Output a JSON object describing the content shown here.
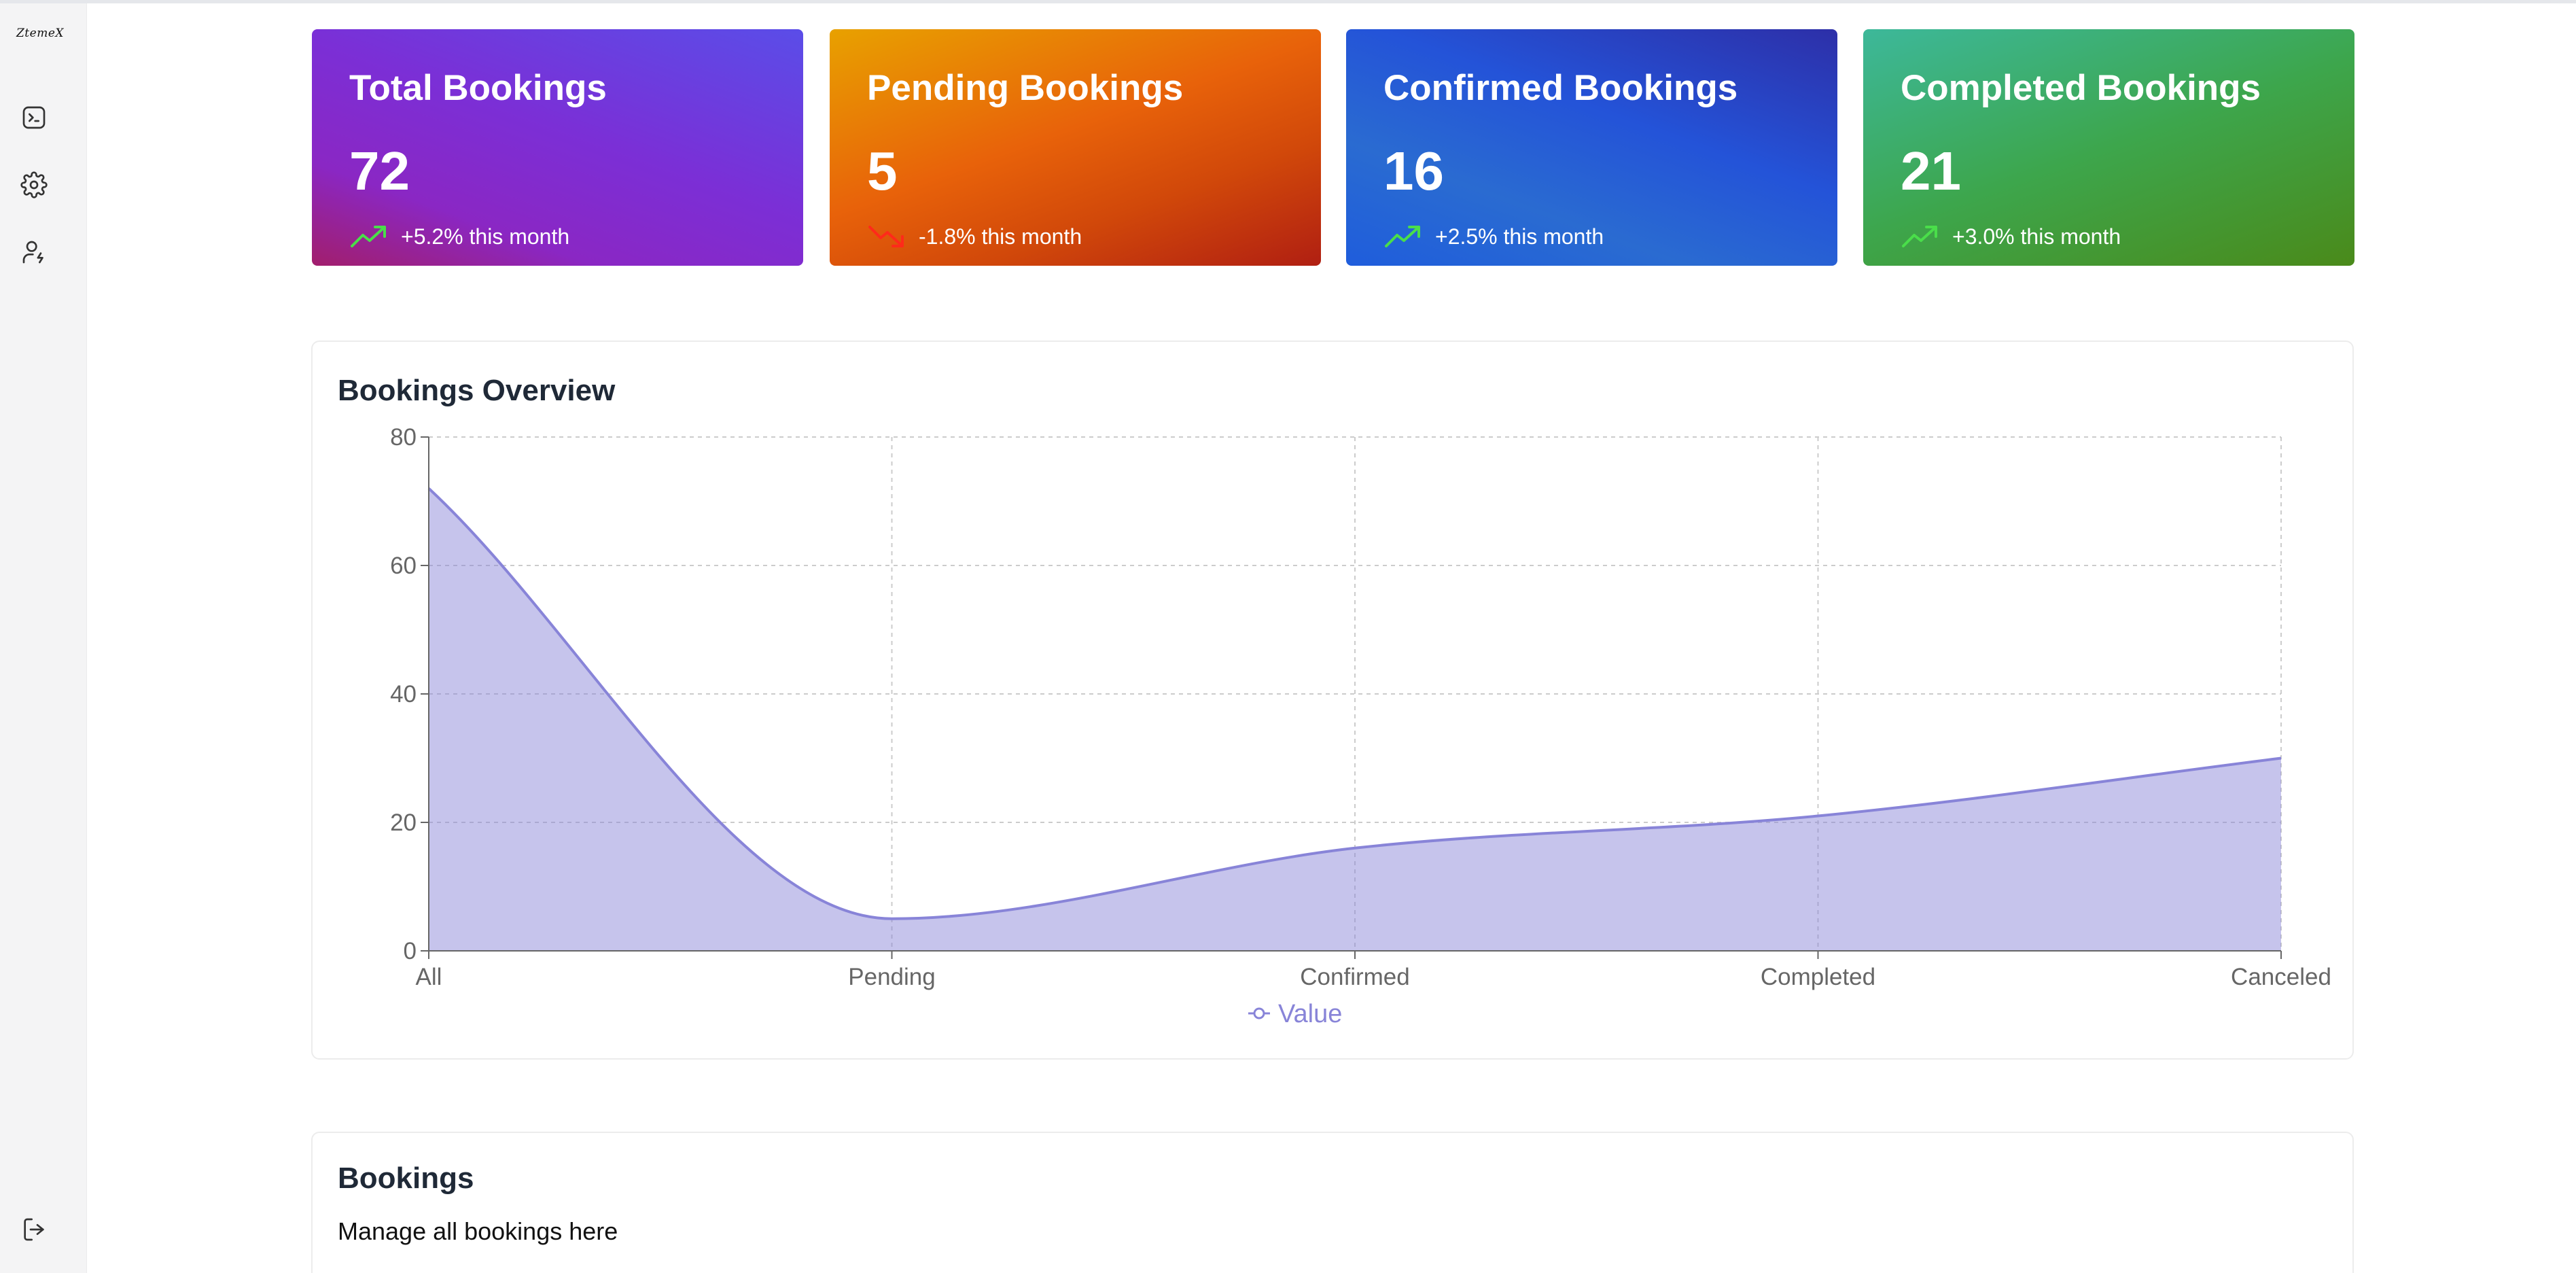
{
  "sidebar": {
    "logo": "ZtemeX",
    "items": [
      {
        "name": "terminal-icon"
      },
      {
        "name": "gear-icon"
      },
      {
        "name": "user-bolt-icon"
      }
    ],
    "bottom": {
      "name": "logout-icon"
    }
  },
  "stats": [
    {
      "title": "Total Bookings",
      "value": "72",
      "trend": "+5.2% this month",
      "direction": "up",
      "trend_color": "#4ade4a"
    },
    {
      "title": "Pending Bookings",
      "value": "5",
      "trend": "-1.8% this month",
      "direction": "down",
      "trend_color": "#ff2a1a"
    },
    {
      "title": "Confirmed Bookings",
      "value": "16",
      "trend": "+2.5% this month",
      "direction": "up",
      "trend_color": "#4ade4a"
    },
    {
      "title": "Completed Bookings",
      "value": "21",
      "trend": "+3.0% this month",
      "direction": "up",
      "trend_color": "#4ade4a"
    }
  ],
  "overview": {
    "title": "Bookings Overview"
  },
  "chart_data": {
    "type": "area",
    "categories": [
      "All",
      "Pending",
      "Confirmed",
      "Completed",
      "Canceled"
    ],
    "series": [
      {
        "name": "Value",
        "values": [
          72,
          5,
          16,
          21,
          30
        ],
        "color": "#8884d8"
      }
    ],
    "ylim": [
      0,
      80
    ],
    "yticks": [
      0,
      20,
      40,
      60,
      80
    ],
    "grid": true,
    "legend": "bottom-center"
  },
  "bookings": {
    "title": "Bookings",
    "subtitle": "Manage all bookings here"
  }
}
